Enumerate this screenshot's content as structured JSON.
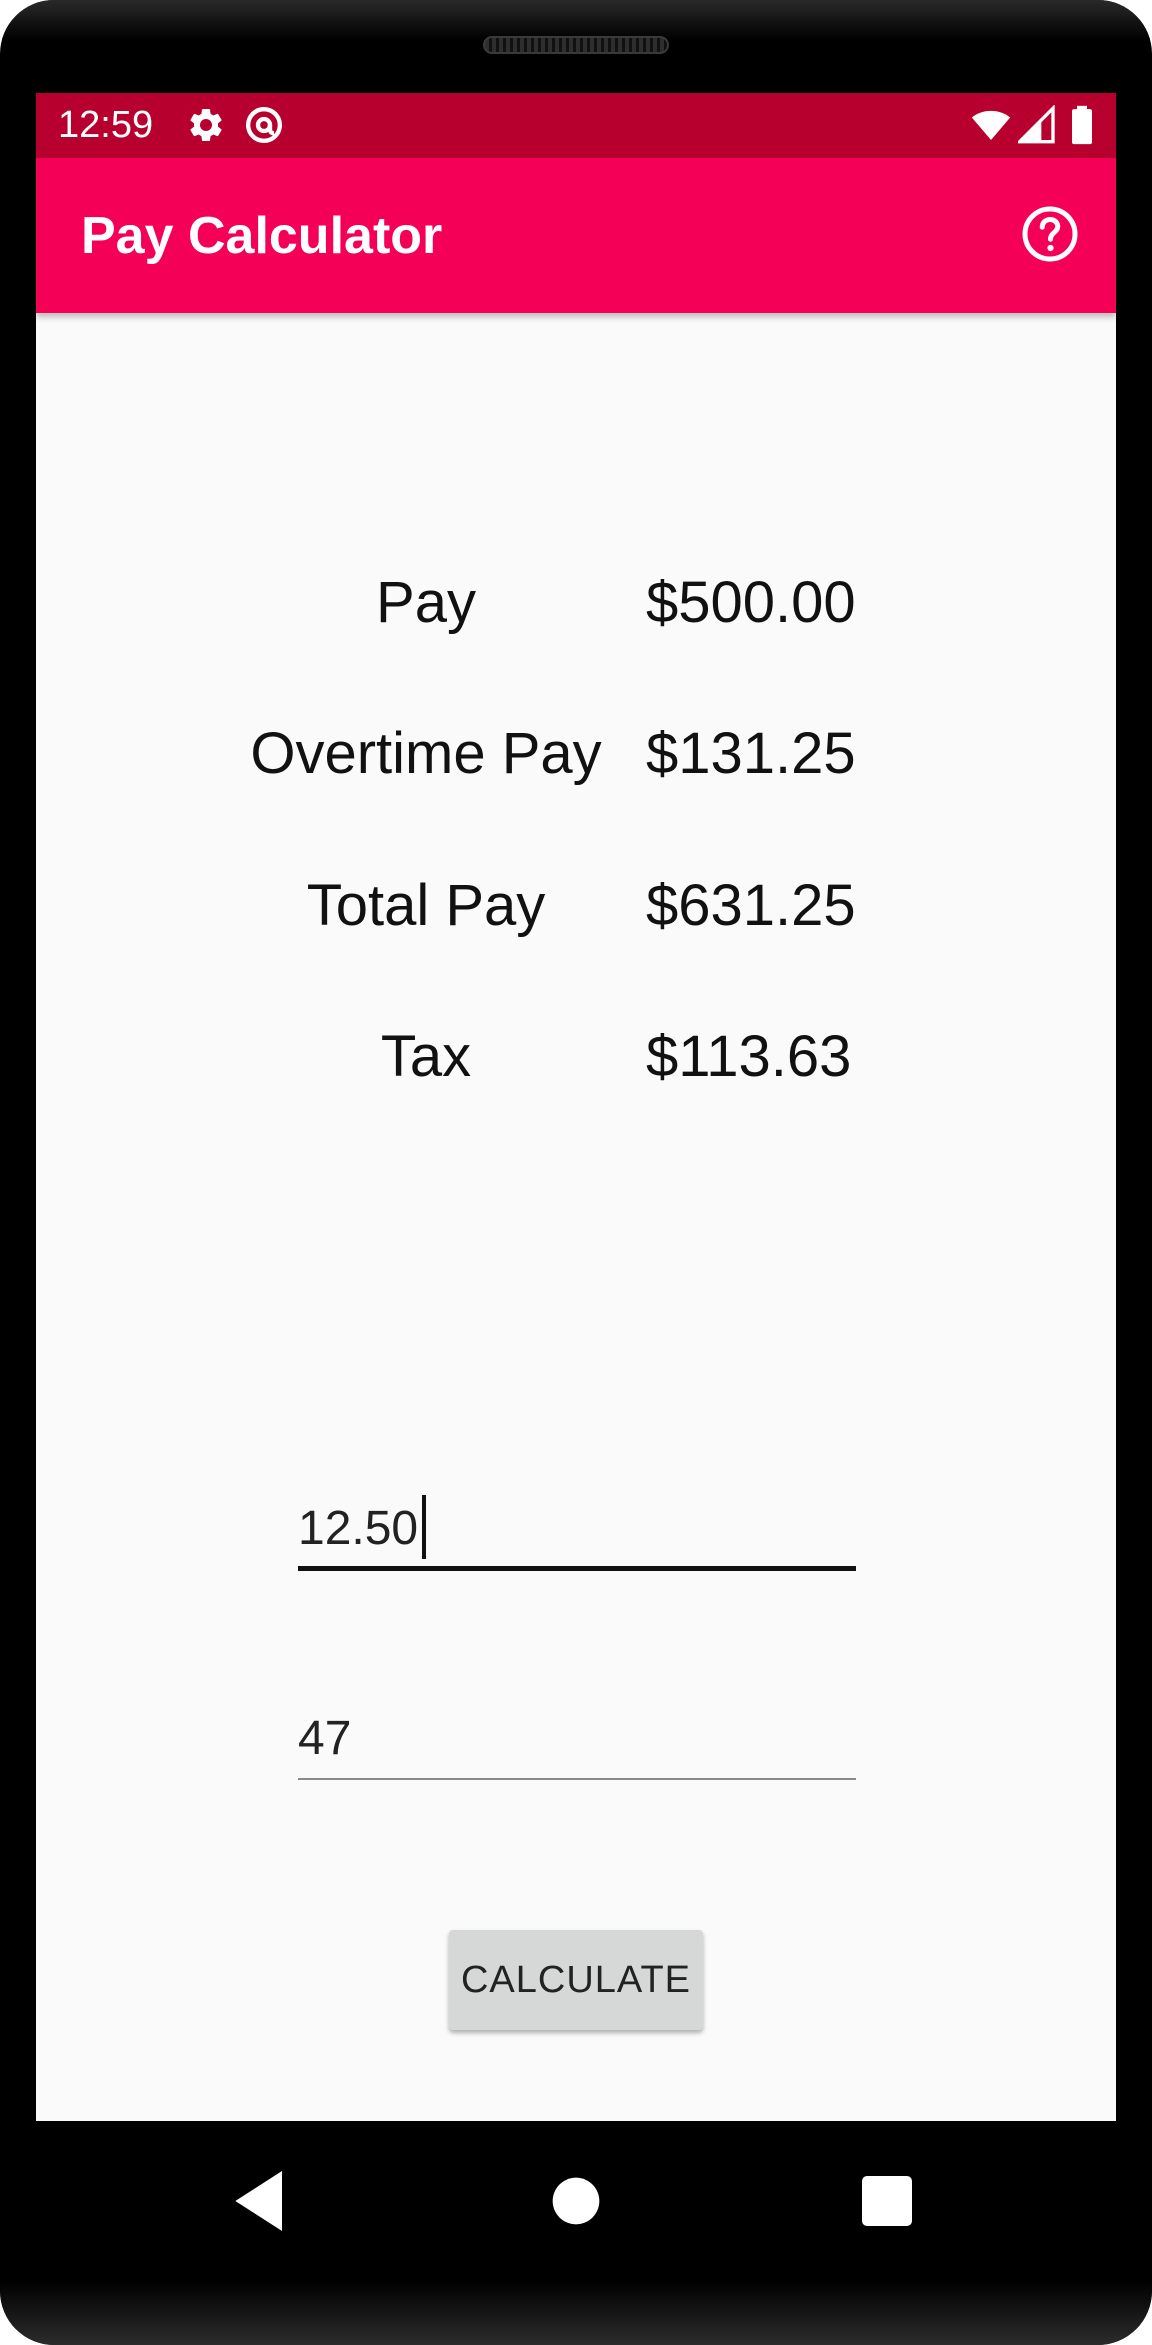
{
  "status_bar": {
    "time": "12:59",
    "left_icons": [
      "gear-icon",
      "at-sign-icon"
    ],
    "right_icons": [
      "wifi-icon",
      "signal-icon",
      "battery-icon"
    ],
    "color": "#b8002e"
  },
  "app_bar": {
    "title": "Pay Calculator",
    "help_icon": "help-circle-icon",
    "color": "#f50057"
  },
  "results": [
    {
      "label": "Pay",
      "value": "$500.00"
    },
    {
      "label": "Overtime Pay",
      "value": "$131.25"
    },
    {
      "label": "Total Pay",
      "value": "$631.25"
    },
    {
      "label": "Tax",
      "value": "$113.63"
    }
  ],
  "inputs": {
    "hourly_rate": {
      "value": "12.50",
      "focused": true
    },
    "hours_worked": {
      "value": "47",
      "focused": false
    }
  },
  "calculate_button": {
    "label": "CALCULATE"
  },
  "nav_bar": {
    "back_icon": "back-triangle-icon",
    "home_icon": "home-circle-icon",
    "recents_icon": "recents-square-icon"
  }
}
